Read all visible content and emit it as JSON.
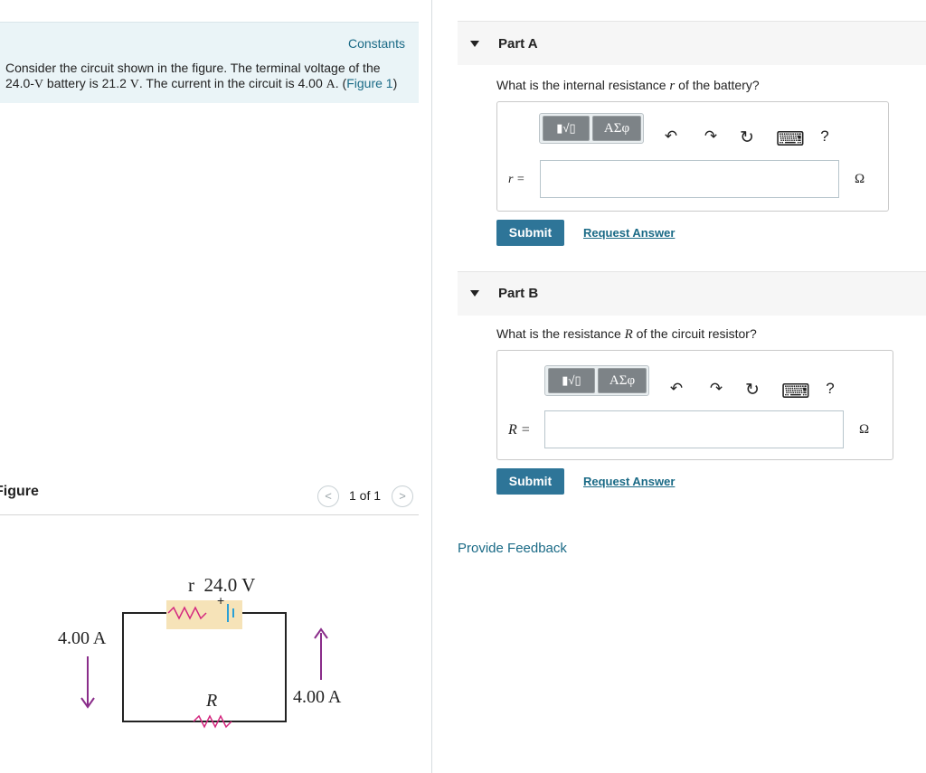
{
  "problem": {
    "constants_label": "Constants",
    "text_part1": "Consider the circuit shown in the figure. The terminal voltage of the 24.0-",
    "text_unit_v": "V",
    "text_part2": " battery is 21.2 ",
    "text_unit_v2": "V",
    "text_part3": ". The current in the circuit is 4.00 ",
    "text_unit_a": "A",
    "text_part4": ". (",
    "figure_link": "Figure 1",
    "text_part5": ")"
  },
  "figure": {
    "label": "Figure",
    "pager_text": "1 of 1",
    "prev_glyph": "<",
    "next_glyph": ">",
    "circuit": {
      "battery_label": "r  24.0 V",
      "left_current": "4.00 A",
      "right_current": "4.00 A",
      "resistor_label": "R",
      "plus_sign": "+"
    }
  },
  "parts": [
    {
      "title": "Part A",
      "question_prefix": "What is the internal resistance ",
      "question_var": "r",
      "question_suffix": " of the battery?",
      "var_label": "r =",
      "unit": "Ω",
      "submit": "Submit",
      "request": "Request Answer"
    },
    {
      "title": "Part B",
      "question_prefix": "What is the resistance ",
      "question_var": "R",
      "question_suffix": " of the circuit resistor?",
      "var_label": "R =",
      "unit": "Ω",
      "submit": "Submit",
      "request": "Request Answer"
    }
  ],
  "toolbar": {
    "templates_glyph": "▮√▯",
    "greek_label": "ΑΣφ",
    "undo_glyph": "↶",
    "redo_glyph": "↷",
    "reset_glyph": "↻",
    "keyboard_glyph": "⌨",
    "help_glyph": "?"
  },
  "feedback_label": "Provide Feedback",
  "colors": {
    "accent": "#2e7598",
    "link": "#1a6a86",
    "constants_bg": "#eaf4f7",
    "circuit_arrow": "#8a2d8a",
    "battery_bg": "#f6e3b8",
    "battery_cell": "#2aa0d6",
    "resistor_pink": "#d4287f"
  }
}
